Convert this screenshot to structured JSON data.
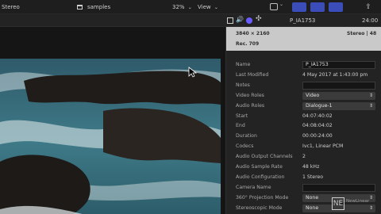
{
  "top": {
    "stereo_label": "Stereo",
    "library_name": "samples",
    "zoom": "32%",
    "view_label": "View",
    "clip_name": "P_IA1753",
    "timecode": "24:00"
  },
  "infobox": {
    "resolution": "3840 × 2160",
    "fps": "Rec. 709",
    "audio": "Stereo | 48"
  },
  "inspector": {
    "rows": [
      {
        "label": "Name",
        "value": "P_IA1753",
        "kind": "field"
      },
      {
        "label": "Last Modified",
        "value": "4 May 2017 at 1:43:00 pm",
        "kind": "text"
      },
      {
        "label": "Notes",
        "value": "",
        "kind": "field"
      },
      {
        "label": "Video Roles",
        "value": "Video",
        "kind": "select"
      },
      {
        "label": "Audio Roles",
        "value": "Dialogue-1",
        "kind": "select"
      },
      {
        "label": "Start",
        "value": "04:07:40:02",
        "kind": "text"
      },
      {
        "label": "End",
        "value": "04:08:04:02",
        "kind": "text"
      },
      {
        "label": "Duration",
        "value": "00:00:24:00",
        "kind": "text"
      },
      {
        "label": "Codecs",
        "value": "Ivc1, Linear PCM",
        "kind": "text"
      },
      {
        "label": "Audio Output Channels",
        "value": "2",
        "kind": "text"
      },
      {
        "label": "Audio Sample Rate",
        "value": "48 kHz",
        "kind": "text"
      },
      {
        "label": "Audio Configuration",
        "value": "1 Stereo",
        "kind": "text"
      },
      {
        "label": "Camera Name",
        "value": "",
        "kind": "field"
      },
      {
        "label": "360° Projection Mode",
        "value": "None",
        "kind": "select"
      },
      {
        "label": "Stereoscopic Mode",
        "value": "None",
        "kind": "select"
      }
    ]
  },
  "watermark": {
    "letters": "NE",
    "word": "NewLinear"
  },
  "colors": {
    "accent_blue": "#3a4db8",
    "purple_dot": "#6a5cff",
    "panel": "#232323",
    "infobox": "#c9c9c9"
  }
}
